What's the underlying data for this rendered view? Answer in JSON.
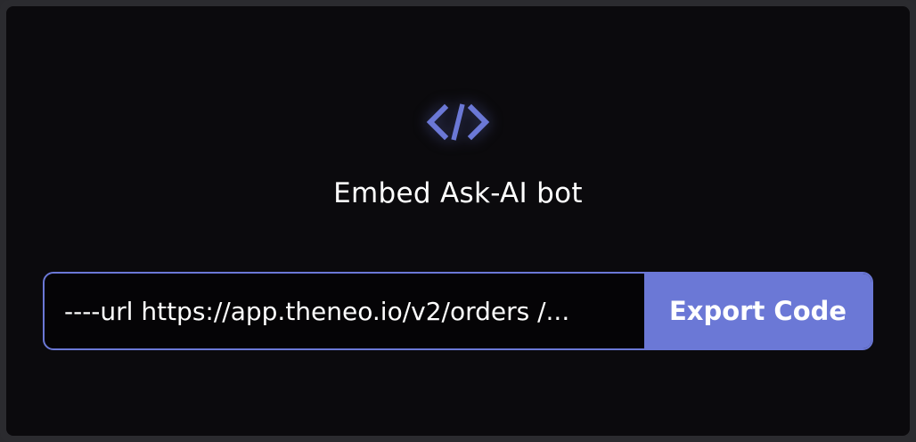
{
  "dialog": {
    "icon": "code-brackets-icon",
    "title": "Embed Ask-AI bot"
  },
  "embed": {
    "code_value": "----url https://app.theneo.io/v2/orders /...",
    "export_label": "Export Code"
  },
  "colors": {
    "accent": "#6b78d6",
    "background": "#0b0a0d",
    "frame": "#2b2b2f",
    "text": "#ffffff"
  }
}
